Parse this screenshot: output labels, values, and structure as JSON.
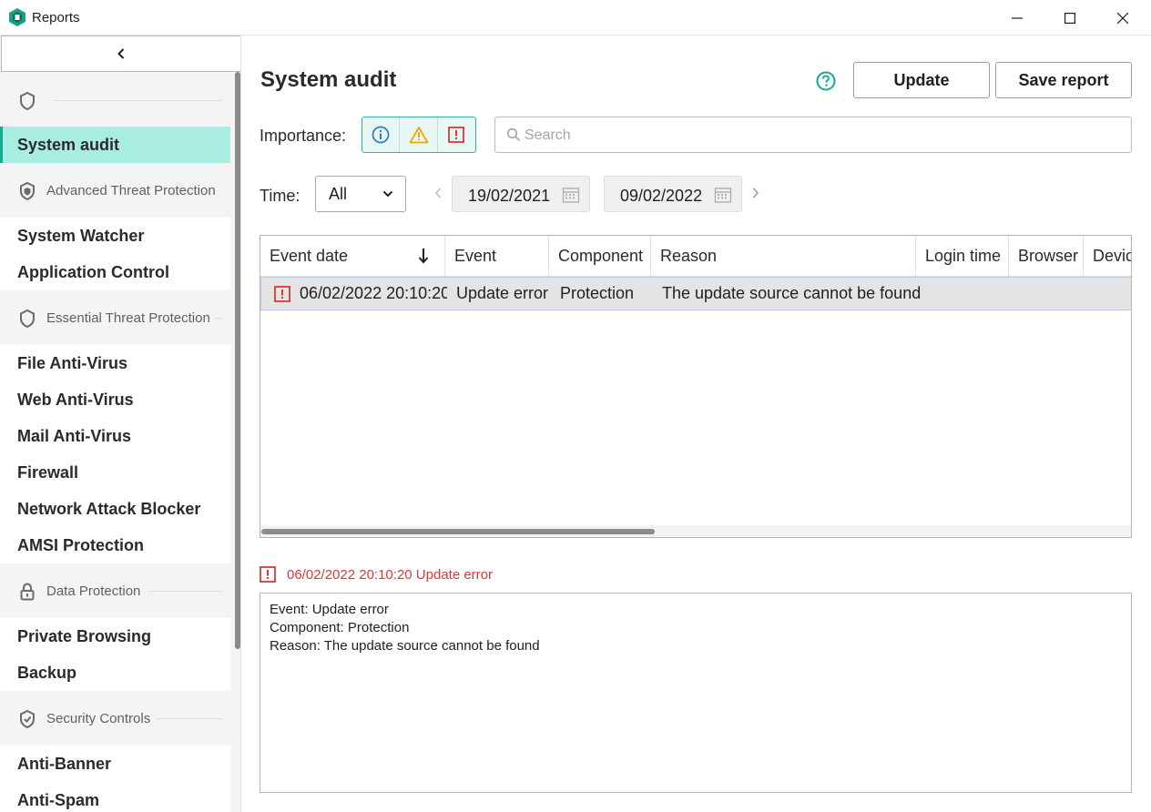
{
  "window": {
    "title": "Reports",
    "icons": {
      "minimize": "minimize-icon",
      "maximize": "maximize-icon",
      "close": "close-icon"
    }
  },
  "sidebar": {
    "collapse_icon": "chevron-left-icon",
    "groups": [
      {
        "section": "",
        "icon": "shield-icon",
        "items": [
          "System audit"
        ]
      },
      {
        "section": "Advanced Threat Protection",
        "icon": "shield-icon",
        "items": [
          "System Watcher",
          "Application Control"
        ]
      },
      {
        "section": "Essential Threat Protection",
        "icon": "shield-icon",
        "items": [
          "File Anti-Virus",
          "Web Anti-Virus",
          "Mail Anti-Virus",
          "Firewall",
          "Network Attack Blocker",
          "AMSI Protection"
        ]
      },
      {
        "section": "Data Protection",
        "icon": "lock-icon",
        "items": [
          "Private Browsing",
          "Backup"
        ]
      },
      {
        "section": "Security Controls",
        "icon": "shield-check-icon",
        "items": [
          "Anti-Banner",
          "Anti-Spam"
        ]
      }
    ],
    "active_item": "System audit"
  },
  "main": {
    "title": "System audit",
    "help_icon": "help-icon",
    "buttons": {
      "update": "Update",
      "save_report": "Save report"
    },
    "importance_label": "Importance:",
    "importance_filters": [
      "info-icon",
      "warning-icon",
      "error-icon"
    ],
    "search": {
      "placeholder": "Search",
      "value": ""
    },
    "time_label": "Time:",
    "time_select": "All",
    "date_from": "19/02/2021",
    "date_to": "09/02/2022"
  },
  "table": {
    "columns": [
      "Event date",
      "Event",
      "Component",
      "Reason",
      "Login time",
      "Browser",
      "Devic"
    ],
    "sort_column": "Event date",
    "sort_direction": "descending",
    "rows": [
      {
        "severity": "error",
        "event_date": "06/02/2022 20:10:20",
        "event": "Update error",
        "component": "Protection",
        "reason": "The update source cannot be found"
      }
    ]
  },
  "details": {
    "title": "06/02/2022 20:10:20 Update error",
    "lines": [
      "Event: Update error",
      "Component: Protection",
      "Reason: The update source cannot be found"
    ]
  },
  "colors": {
    "accent": "#14a98d",
    "active_bg": "#a9ece0",
    "error": "#d63a3a",
    "warning": "#f0a500",
    "info": "#2d7fc1"
  }
}
